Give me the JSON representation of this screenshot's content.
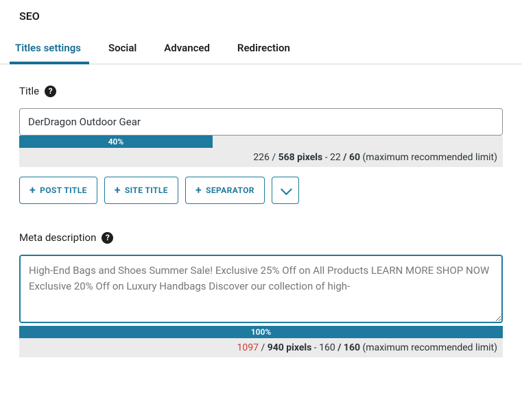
{
  "page_title": "SEO",
  "tabs": {
    "titles_settings": "Titles settings",
    "social": "Social",
    "advanced": "Advanced",
    "redirection": "Redirection"
  },
  "title_field": {
    "label": "Title",
    "value": "DerDragon Outdoor Gear",
    "progress_percent": "40%",
    "progress_width": "40%",
    "pixels_used": "226",
    "pixels_max": "568 pixels",
    "chars_used": "22",
    "chars_max": "60",
    "limit_suffix": "(maximum recommended limit)"
  },
  "tokens": {
    "post_title": "POST TITLE",
    "site_title": "SITE TITLE",
    "separator": "SEPARATOR"
  },
  "meta_field": {
    "label": "Meta description",
    "value": "High-End Bags and Shoes Summer Sale! Exclusive 25% Off on All Products LEARN MORE SHOP NOW Exclusive 20% Off on Luxury Handbags Discover our collection of high-",
    "progress_percent": "100%",
    "progress_width": "100%",
    "pixels_used": "1097",
    "pixels_max": "940 pixels",
    "chars_used": "160",
    "chars_max": "160",
    "limit_suffix": "(maximum recommended limit)"
  }
}
